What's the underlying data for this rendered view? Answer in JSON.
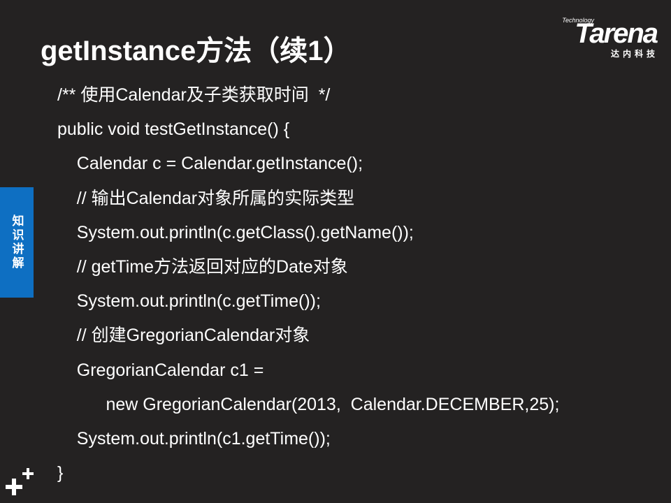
{
  "slide": {
    "title": "getInstance方法（续1）"
  },
  "logo": {
    "tagline": "Technology",
    "name": "Tarena",
    "subtitle": "达内科技"
  },
  "side_tab": {
    "label": "知识讲解"
  },
  "code_lines": [
    "/** 使用Calendar及子类获取时间  */",
    "public void testGetInstance() {",
    "    Calendar c = Calendar.getInstance();",
    "    // 输出Calendar对象所属的实际类型",
    "    System.out.println(c.getClass().getName());",
    "    // getTime方法返回对应的Date对象",
    "    System.out.println(c.getTime());",
    "    // 创建GregorianCalendar对象",
    "    GregorianCalendar c1 =",
    "          new GregorianCalendar(2013,  Calendar.DECEMBER,25);",
    "    System.out.println(c1.getTime());",
    "}"
  ],
  "icons": {
    "corner": "plus-icon"
  },
  "colors": {
    "background": "#242222",
    "accent": "#0e6fc2",
    "text": "#ffffff"
  }
}
